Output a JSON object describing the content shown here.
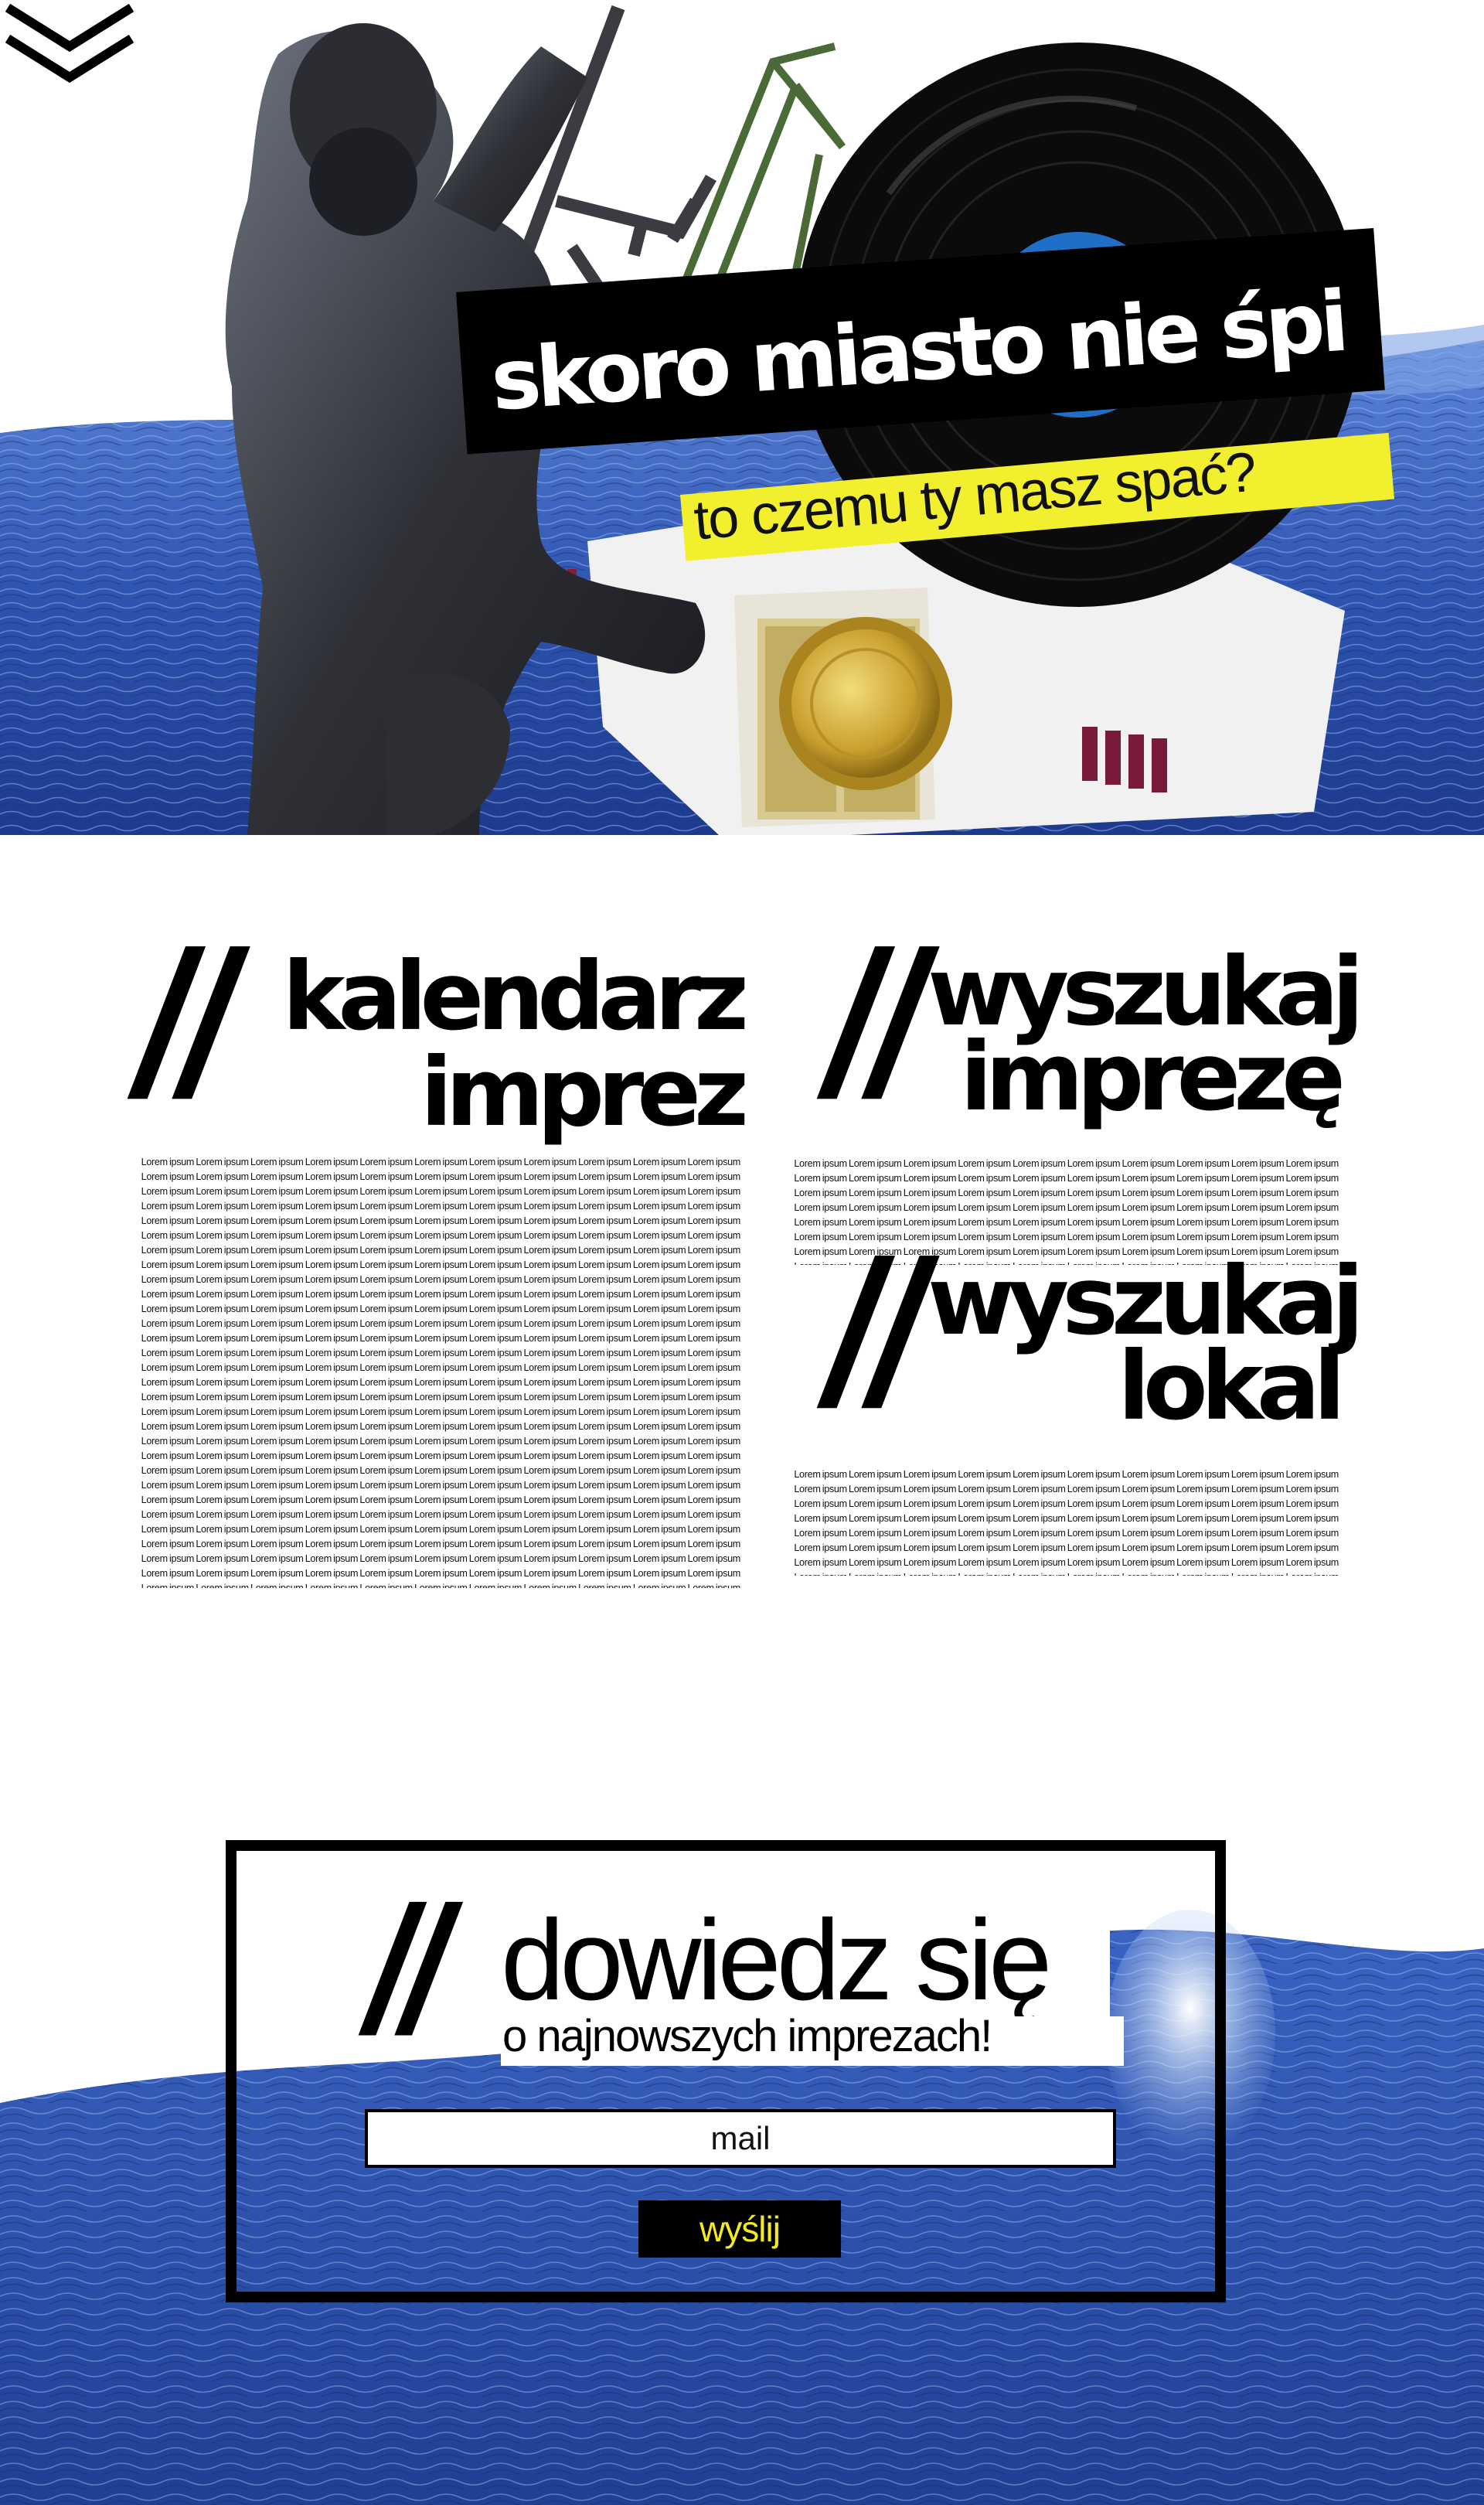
{
  "hero": {
    "title": "skoro miasto nie śpi",
    "subtitle": "to czemu ty masz spać?"
  },
  "calendar": {
    "heading_line1": "kalendarz",
    "heading_line2": "imprez",
    "body": "Lorem ipsum Lorem ipsum Lorem ipsum Lorem ipsum Lorem ipsum Lorem ipsum Lorem ipsum Lorem ipsum Lorem ipsum Lorem ipsum Lorem ipsum Lorem ipsum Lorem ipsum Lorem ipsum Lorem ipsum Lorem ipsum Lorem ipsum Lorem ipsum Lorem ipsum Lorem ipsum Lorem ipsum Lorem ipsum Lorem ipsum Lorem ipsum Lorem ipsum Lorem ipsum Lorem ipsum Lorem ipsum Lorem ipsum Lorem ipsum Lorem ipsum Lorem ipsum Lorem ipsum Lorem ipsum Lorem ipsum Lorem ipsum Lorem ipsum Lorem ipsum Lorem ipsum Lorem ipsum Lorem ipsum Lorem ipsum Lorem ipsum Lorem ipsum Lorem ipsum Lorem ipsum Lorem ipsum Lorem ipsum Lorem ipsum Lorem ipsum Lorem ipsum Lorem ipsum Lorem ipsum Lorem ipsum Lorem ipsum Lorem ipsum Lorem ipsum Lorem ipsum Lorem ipsum Lorem ipsum Lorem ipsum Lorem ipsum Lorem ipsum Lorem ipsum Lorem ipsum Lorem ipsum Lorem ipsum Lorem ipsum Lorem ipsum Lorem ipsum Lorem ipsum Lorem ipsum Lorem ipsum Lorem ipsum Lorem ipsum Lorem ipsum Lorem ipsum Lorem ipsum Lorem ipsum Lorem ipsum Lorem ipsum Lorem ipsum Lorem ipsum Lorem ipsum Lorem ipsum Lorem ipsum Lorem ipsum Lorem ipsum Lorem ipsum Lorem ipsum Lorem ipsum Lorem ipsum Lorem ipsum Lorem ipsum Lorem ipsum Lorem ipsum Lorem ipsum Lorem ipsum Lorem ipsum Lorem ipsum Lorem ipsum Lorem ipsum Lorem ipsum Lorem ipsum Lorem ipsum Lorem ipsum Lorem ipsum Lorem ipsum Lorem ipsum Lorem ipsum Lorem ipsum Lorem ipsum Lorem ipsum Lorem ipsum Lorem ipsum Lorem ipsum Lorem ipsum Lorem ipsum Lorem ipsum Lorem ipsum Lorem ipsum Lorem ipsum Lorem ipsum Lorem ipsum Lorem ipsum Lorem ipsum Lorem ipsum Lorem ipsum Lorem ipsum Lorem ipsum Lorem ipsum Lorem ipsum Lorem ipsum Lorem ipsum Lorem ipsum Lorem ipsum Lorem ipsum Lorem ipsum Lorem ipsum Lorem ipsum Lorem ipsum Lorem ipsum Lorem ipsum Lorem ipsum Lorem ipsum Lorem ipsum Lorem ipsum Lorem ipsum Lorem ipsum Lorem ipsum Lorem ipsum Lorem ipsum Lorem ipsum Lorem ipsum Lorem ipsum Lorem ipsum Lorem ipsum Lorem ipsum Lorem ipsum Lorem ipsum Lorem ipsum Lorem ipsum Lorem ipsum Lorem ipsum Lorem ipsum Lorem ipsum Lorem ipsum Lorem ipsum Lorem ipsum Lorem ipsum Lorem ipsum Lorem ipsum Lorem ipsum Lorem ipsum Lorem ipsum Lorem ipsum Lorem ipsum Lorem ipsum Lorem ipsum Lorem ipsum Lorem ipsum Lorem ipsum Lorem ipsum Lorem ipsum Lorem ipsum Lorem ipsum Lorem ipsum Lorem ipsum Lorem ipsum Lorem ipsum Lorem ipsum Lorem ipsum Lorem ipsum Lorem ipsum Lorem ipsum Lorem ipsum Lorem ipsum Lorem ipsum Lorem ipsum Lorem ipsum Lorem ipsum Lorem ipsum Lorem ipsum Lorem ipsum Lorem ipsum Lorem ipsum Lorem ipsum Lorem ipsum Lorem ipsum Lorem ipsum Lorem ipsum Lorem ipsum Lorem ipsum Lorem ipsum Lorem ipsum Lorem ipsum Lorem ipsum Lorem ipsum Lorem ipsum Lorem ipsum Lorem ipsum Lorem ipsum Lorem ipsum Lorem ipsum Lorem ipsum Lorem ipsum Lorem ipsum Lorem ipsum Lorem ipsum Lorem ipsum Lorem ipsum Lorem ipsum Lorem ipsum Lorem ipsum Lorem ipsum Lorem ipsum Lorem ipsum Lorem ipsum Lorem ipsum Lorem ipsum Lorem ipsum Lorem ipsum Lorem ipsum Lorem ipsum Lorem ipsum Lorem ipsum Lorem ipsum Lorem ipsum Lorem ipsum Lorem ipsum Lorem ipsum Lorem ipsum Lorem ipsum Lorem ipsum Lorem ipsum Lorem ipsum Lorem ipsum Lorem ipsum Lorem ipsum Lorem ipsum Lorem ipsum Lorem ipsum Lorem ipsum Lorem ipsum Lorem ipsum Lorem ipsum Lorem ipsum Lorem ipsum Lorem ipsum Lorem ipsum Lorem ipsum Lorem ipsum Lorem ipsum Lorem ipsum Lorem ipsum Lorem ipsum Lorem ipsum Lorem ipsum Lorem ipsum Lorem ipsum Lorem ipsum Lorem ipsum Lorem ipsum Lorem ipsum Lorem ipsum Lorem ipsum Lorem ipsum Lorem ipsum Lorem ipsum Lorem ipsum Lorem ipsum Lorem ipsum Lorem ipsum Lorem ipsum Lorem ipsum Lorem ipsum Lorem ipsum Lorem ipsum Lorem ipsum Lorem ipsum Lorem ipsum Lorem ipsum Lorem ipsum Lorem ipsum Lorem ipsum Lorem ipsum Lorem ipsum Lorem ipsum Lorem ipsum Lorem ipsum Lorem ipsum Lorem ipsum Lorem ipsum Lorem ipsum Lorem ipsum Lorem ipsum Lorem ipsum Lorem ipsum Lorem ipsum Lorem ipsum Lorem ipsum Lorem ipsum Lorem ipsum Lorem ipsum Lorem ipsum Lorem ipsum Lorem ipsum Lorem ipsum Lorem ipsum Lorem ipsum Lorem ipsum Lorem ipsum Lorem ipsum Lorem ipsum Lorem ipsum Lorem ipsum Lorem ipsum Lorem ipsum Lorem ipsum Lorem ipsum Lorem ipsum Lorem ipsum Lorem ipsum Lorem ipsum Lorem ipsum Lorem ipsum Lorem ipsum Lorem ipsum Lorem ipsum Lorem ipsum Lorem ipsum Lorem ipsum Lorem ipsum Lorem ipsum Lorem ipsum Lorem ipsum"
  },
  "search_party": {
    "heading_line1": "wyszukaj",
    "heading_line2": "imprezę",
    "body": "Lorem ipsum Lorem ipsum Lorem ipsum Lorem ipsum Lorem ipsum Lorem ipsum Lorem ipsum Lorem ipsum Lorem ipsum Lorem ipsum Lorem ipsum Lorem ipsum Lorem ipsum Lorem ipsum Lorem ipsum Lorem ipsum Lorem ipsum Lorem ipsum Lorem ipsum Lorem ipsum Lorem ipsum Lorem ipsum Lorem ipsum Lorem ipsum Lorem ipsum Lorem ipsum Lorem ipsum Lorem ipsum Lorem ipsum Lorem ipsum Lorem ipsum Lorem ipsum Lorem ipsum Lorem ipsum Lorem ipsum Lorem ipsum Lorem ipsum Lorem ipsum Lorem ipsum Lorem ipsum Lorem ipsum Lorem ipsum Lorem ipsum Lorem ipsum Lorem ipsum Lorem ipsum Lorem ipsum Lorem ipsum Lorem ipsum Lorem ipsum Lorem ipsum Lorem ipsum Lorem ipsum Lorem ipsum Lorem ipsum Lorem ipsum Lorem ipsum Lorem ipsum Lorem ipsum Lorem ipsum Lorem ipsum Lorem ipsum Lorem ipsum Lorem ipsum Lorem ipsum Lorem ipsum Lorem ipsum Lorem ipsum Lorem ipsum Lorem ipsum Lorem ipsum Lorem ipsum Lorem ipsum Lorem ipsum Lorem ipsum Lorem ipsum Lorem ipsum Lorem ipsum Lorem ipsum Lorem ipsum Lorem ipsum Lorem ipsum Lorem ipsum Lorem ipsum Lorem ipsum Lorem ipsum Lorem ipsum Lorem ipsum"
  },
  "search_venue": {
    "heading_line1": "wyszukaj",
    "heading_line2": "lokal",
    "body": "Lorem ipsum Lorem ipsum Lorem ipsum Lorem ipsum Lorem ipsum Lorem ipsum Lorem ipsum Lorem ipsum Lorem ipsum Lorem ipsum Lorem ipsum Lorem ipsum Lorem ipsum Lorem ipsum Lorem ipsum Lorem ipsum Lorem ipsum Lorem ipsum Lorem ipsum Lorem ipsum Lorem ipsum Lorem ipsum Lorem ipsum Lorem ipsum Lorem ipsum Lorem ipsum Lorem ipsum Lorem ipsum Lorem ipsum Lorem ipsum Lorem ipsum Lorem ipsum Lorem ipsum Lorem ipsum Lorem ipsum Lorem ipsum Lorem ipsum Lorem ipsum Lorem ipsum Lorem ipsum Lorem ipsum Lorem ipsum Lorem ipsum Lorem ipsum Lorem ipsum Lorem ipsum Lorem ipsum Lorem ipsum Lorem ipsum Lorem ipsum Lorem ipsum Lorem ipsum Lorem ipsum Lorem ipsum Lorem ipsum Lorem ipsum Lorem ipsum Lorem ipsum Lorem ipsum Lorem ipsum Lorem ipsum Lorem ipsum Lorem ipsum Lorem ipsum Lorem ipsum Lorem ipsum Lorem ipsum Lorem ipsum Lorem ipsum Lorem ipsum Lorem ipsum Lorem ipsum Lorem ipsum Lorem ipsum Lorem ipsum Lorem ipsum Lorem ipsum Lorem ipsum Lorem ipsum Lorem ipsum Lorem ipsum Lorem ipsum Lorem ipsum Lorem ipsum Lorem ipsum Lorem ipsum Lorem ipsum"
  },
  "slash_mark": "//",
  "newsletter": {
    "title": "dowiedz się",
    "subtitle": "o najnowszych imprezach!",
    "email_placeholder": "mail",
    "submit_label": "wyślij"
  },
  "colors": {
    "ocean": "#2d4fa8",
    "highlight_yellow": "#f2ef2e",
    "button_text_yellow": "#f5ea21",
    "record_label_blue": "#1f6fc8"
  },
  "icons": {
    "scroll_down": "chevron-double-down-icon",
    "vinyl_record": "vinyl-record-icon",
    "bottle_cap": "bottle-cap-icon"
  }
}
